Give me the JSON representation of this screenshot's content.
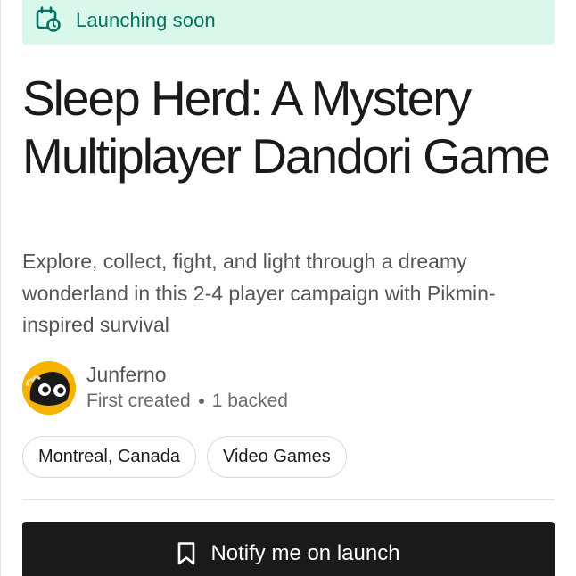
{
  "banner": {
    "icon": "calendar-clock-icon",
    "text": "Launching soon",
    "text_color": "#037362",
    "background": "#d9f7ea"
  },
  "project": {
    "title": "Sleep Herd: A Mystery Multiplayer Dandori Game",
    "blurb": "Explore, collect, fight, and light through a dreamy wonderland in this 2-4 player campaign with Pikmin-inspired survival"
  },
  "creator": {
    "avatar": "creator-avatar",
    "avatar_color": "#f5b300",
    "name": "Junferno",
    "status": "First created",
    "backed": "1 backed"
  },
  "tags": [
    {
      "label": "Montreal, Canada"
    },
    {
      "label": "Video Games"
    }
  ],
  "cta": {
    "icon": "bookmark-icon",
    "label": "Notify me on launch",
    "background": "#1a1a1a"
  }
}
